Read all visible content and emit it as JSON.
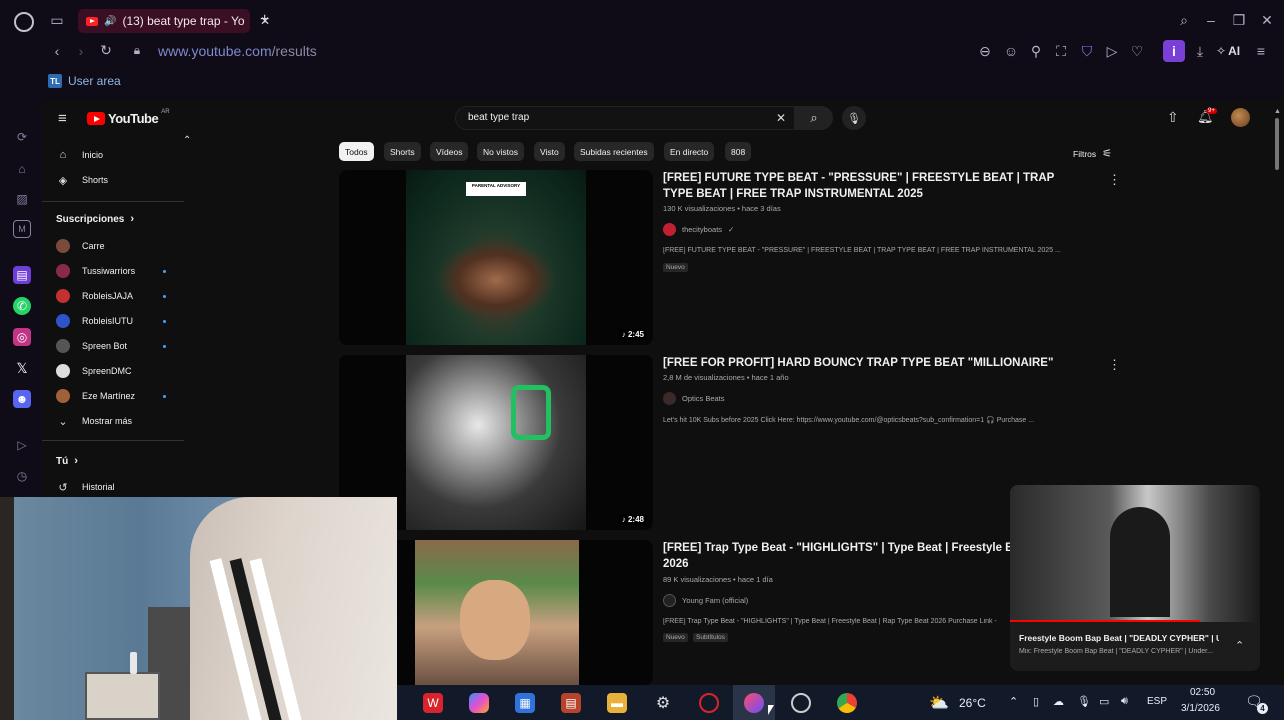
{
  "browser": {
    "tab_title": "(13) beat type trap - Yo",
    "new_tab": "+",
    "url_host": "www.youtube.com",
    "url_path": "/results",
    "user_area": "User area",
    "toolbar_ai": "AI",
    "user_area_logo": "TL"
  },
  "youtube": {
    "logo": "YouTube",
    "logo_region": "AR",
    "search_query": "beat type trap",
    "notif_count": "9+",
    "sidebar": {
      "items": [
        {
          "label": "Inicio",
          "icon": "home-icon"
        },
        {
          "label": "Shorts",
          "icon": "shorts-icon"
        }
      ],
      "subscriptions_title": "Suscripciones",
      "subscriptions": [
        {
          "label": "Carre",
          "color": "#7a4a3a",
          "dot": false
        },
        {
          "label": "Tussiwarriors",
          "color": "#8a2a4a",
          "dot": true
        },
        {
          "label": "RobleisJAJA",
          "color": "#c23030",
          "dot": true
        },
        {
          "label": "RobleisIUTU",
          "color": "#2f54c9",
          "dot": true
        },
        {
          "label": "Spreen Bot",
          "color": "#555",
          "dot": true
        },
        {
          "label": "SpreenDMC",
          "color": "#dddddd",
          "dot": false
        },
        {
          "label": "Eze Martínez",
          "color": "#a0603a",
          "dot": true
        }
      ],
      "show_more": "Mostrar más",
      "you_title": "Tú",
      "history": "Historial"
    },
    "chips": [
      "Todos",
      "Shorts",
      "Vídeos",
      "No vistos",
      "Visto",
      "Subidas recientes",
      "En directo",
      "808"
    ],
    "filters": "Filtros",
    "videos": [
      {
        "title": "[FREE] FUTURE TYPE BEAT - \"PRESSURE\" | FREESTYLE BEAT | TRAP TYPE BEAT | FREE TRAP INSTRUMENTAL 2025",
        "meta": "130 K visualizaciones • hace 3 días",
        "channel": "thecityboats",
        "desc": "[FREE] FUTURE TYPE BEAT - \"PRESSURE\" | FREESTYLE BEAT | TRAP TYPE BEAT | FREE TRAP INSTRUMENTAL 2025 ...",
        "badge": "Nuevo",
        "duration": "2:45"
      },
      {
        "title": "[FREE FOR PROFIT] HARD BOUNCY TRAP TYPE BEAT \"MILLIONAIRE\"",
        "meta": "2,8 M de visualizaciones • hace 1 año",
        "channel": "Optics Beats",
        "desc": "Let's hit 10K Subs before 2025 Click Here: https://www.youtube.com/@opticsbeats?sub_confirmation=1 🎧 Purchase ...",
        "duration": "2:48"
      },
      {
        "title": "[FREE] Trap Type Beat - \"HIGHLIGHTS\" | Type Beat | Freestyle Beat | Ra",
        "title2": "2026",
        "meta": "89 K visualizaciones • hace 1 día",
        "channel": "Young Fam (official)",
        "desc": "[FREE] Trap Type Beat - \"HIGHLIGHTS\" | Type Beat | Freestyle Beat | Rap Type Beat 2026 Purchase Link -",
        "badges": [
          "Nuevo",
          "Subtítulos"
        ]
      }
    ],
    "thumb1_label": "PARENTAL ADVISORY",
    "miniplayer": {
      "title": "Freestyle Boom Bap Beat | \"DEADLY CYPHER\" | U...",
      "subtitle": "Mix: Freestyle Boom Bap Beat | \"DEADLY CYPHER\" | Under..."
    }
  },
  "taskbar": {
    "temperature": "26°C",
    "language": "ESP",
    "time": "02:50",
    "date": "3/1/2026",
    "notifications": "4"
  }
}
